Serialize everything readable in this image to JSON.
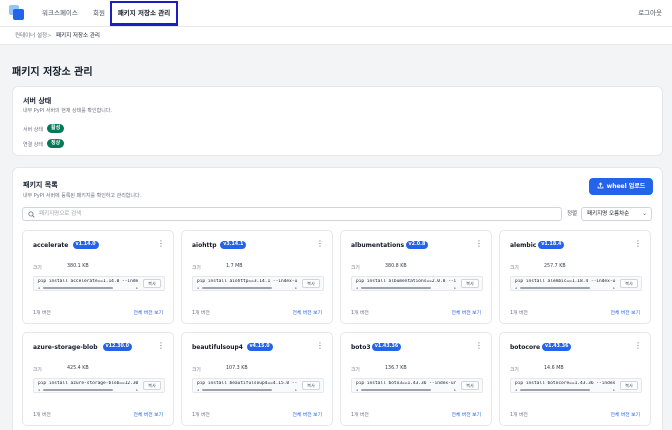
{
  "nav": {
    "items": [
      "워크스페이스",
      "회원"
    ],
    "active": "패키지 저장소 관리",
    "logout": "로그아웃"
  },
  "breadcrumb": {
    "parent": "컨테이너 설정",
    "separator": ">",
    "current": "패키지 저장소 관리"
  },
  "page_title": "패키지 저장소 관리",
  "server": {
    "title": "서버 상태",
    "desc": "내부 PyPI 서버의 현재 상태를 확인합니다.",
    "server_label": "서버 상태",
    "server_value": "활성",
    "conn_label": "연결 상태",
    "conn_value": "정상"
  },
  "packages": {
    "title": "패키지 목록",
    "desc": "내부 PyPI 서버에 등록된 패키지를 확인하고 관리합니다.",
    "upload_label": "wheel 업로드",
    "search_placeholder": "패키지명으로 검색",
    "sort_label": "정렬",
    "sort_value": "패키지명 오름차순",
    "size_label": "크기",
    "copy_label": "복사",
    "all_versions": "전체 버전 보기",
    "items": [
      {
        "name": "accelerate",
        "version": "v1.14.0",
        "size": "380.1 KB",
        "cmd": "pip install accelerate==1.14.0 --index-url",
        "count": "1개 버전"
      },
      {
        "name": "aiohttp",
        "version": "v3.14.1",
        "size": "1.7 MB",
        "cmd": "pip install aiohttp==3.14.1 --index-url",
        "count": "1개 버전"
      },
      {
        "name": "albumentations",
        "version": "v2.0.8",
        "size": "380.8 KB",
        "cmd": "pip install albumentations==2.0.8 --index-url",
        "count": "1개 버전"
      },
      {
        "name": "alembic",
        "version": "v1.18.4",
        "size": "257.7 KB",
        "cmd": "pip install alembic==1.18.4 --index-url",
        "count": "1개 버전"
      },
      {
        "name": "azure-storage-blob",
        "version": "v12.30.0",
        "size": "425.4 KB",
        "cmd": "pip install azure-storage-blob==12.30.0 --index-url",
        "count": "1개 버전"
      },
      {
        "name": "beautifulsoup4",
        "version": "v4.15.0",
        "size": "107.3 KB",
        "cmd": "pip install beautifulsoup4==4.15.0 --index-url",
        "count": "1개 버전"
      },
      {
        "name": "boto3",
        "version": "v1.43.36",
        "size": "136.7 KB",
        "cmd": "pip install boto3==1.43.36 --index-url",
        "count": "1개 버전"
      },
      {
        "name": "botocore",
        "version": "v1.43.36",
        "size": "14.6 MB",
        "cmd": "pip install botocore==1.43.36 --index-url",
        "count": "1개 버전"
      }
    ]
  }
}
